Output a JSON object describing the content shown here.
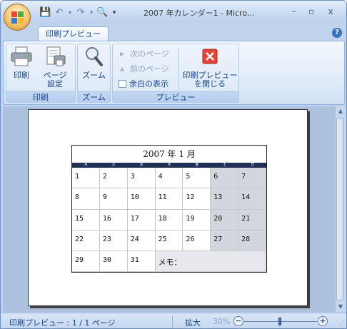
{
  "window": {
    "title": "2007 年カレンダー1 - Micro...",
    "controls": {
      "minimize": "–",
      "maximize": "▫",
      "close": "x"
    }
  },
  "qat": {
    "save_icon": "save-icon",
    "undo_icon": "undo-icon",
    "redo_icon": "redo-icon",
    "preview_icon": "print-preview-icon",
    "customize": "▾"
  },
  "tabs": [
    {
      "label": "印刷プレビュー",
      "active": true
    }
  ],
  "ribbon": {
    "groups": {
      "print": {
        "label": "印刷",
        "print_button": "印刷",
        "page_setup_line1": "ページ",
        "page_setup_line2": "設定"
      },
      "zoom": {
        "label": "ズーム",
        "zoom_button": "ズーム"
      },
      "preview": {
        "label": "プレビュー",
        "next_page": "次のページ",
        "prev_page": "前のページ",
        "show_margins": "余白の表示",
        "show_margins_checked": false,
        "close_line1": "印刷プレビュー",
        "close_line2": "を閉じる"
      }
    }
  },
  "calendar": {
    "title": "2007 年 1 月",
    "weekdays": [
      "月",
      "火",
      "水",
      "木",
      "金",
      "土",
      "日"
    ],
    "rows": [
      [
        "1",
        "2",
        "3",
        "4",
        "5",
        "6",
        "7"
      ],
      [
        "8",
        "9",
        "10",
        "11",
        "12",
        "13",
        "14"
      ],
      [
        "15",
        "16",
        "17",
        "18",
        "19",
        "20",
        "21"
      ],
      [
        "22",
        "23",
        "24",
        "25",
        "26",
        "27",
        "28"
      ]
    ],
    "last_row": [
      "29",
      "30",
      "31"
    ],
    "memo_label": "メモ："
  },
  "status": {
    "page_info": "印刷プレビュー : 1 / 1 ページ",
    "zoom_label": "拡大",
    "zoom_percent": "30%",
    "zoom_out": "−",
    "zoom_in": "+"
  },
  "colors": {
    "accent": "#15428b",
    "calendar_header": "#1f2f55",
    "weekend_fill": "#d3d6dc"
  }
}
